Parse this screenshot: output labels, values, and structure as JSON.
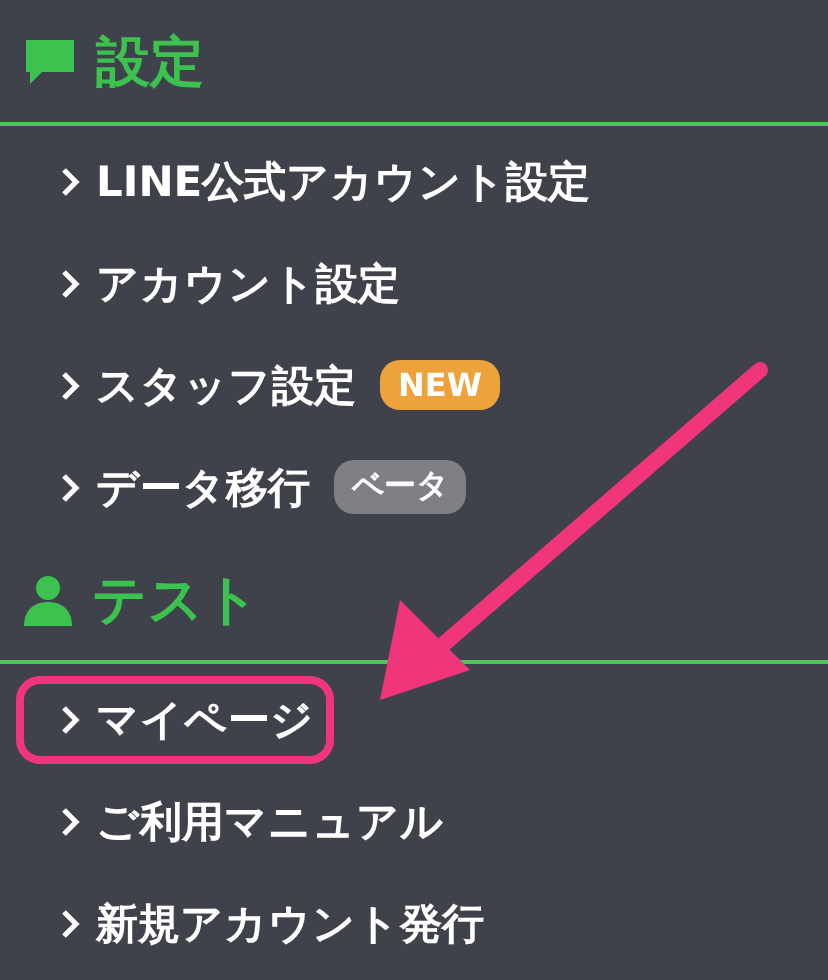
{
  "sections": [
    {
      "title": "設定",
      "kind": "chat",
      "items": [
        {
          "label": "LINE公式アカウント設定",
          "highlighted": false
        },
        {
          "label": "アカウント設定",
          "highlighted": false
        },
        {
          "label": "スタッフ設定",
          "highlighted": false,
          "badge": {
            "text": "NEW",
            "kind": "new"
          }
        },
        {
          "label": "データ移行",
          "highlighted": false,
          "badge": {
            "text": "ベータ",
            "kind": "beta"
          }
        }
      ]
    },
    {
      "title": "テスト",
      "kind": "person",
      "items": [
        {
          "label": "マイページ",
          "highlighted": true
        },
        {
          "label": "ご利用マニュアル",
          "highlighted": false
        },
        {
          "label": "新規アカウント発行",
          "highlighted": false
        }
      ]
    }
  ],
  "annotation": {
    "arrow": true
  }
}
